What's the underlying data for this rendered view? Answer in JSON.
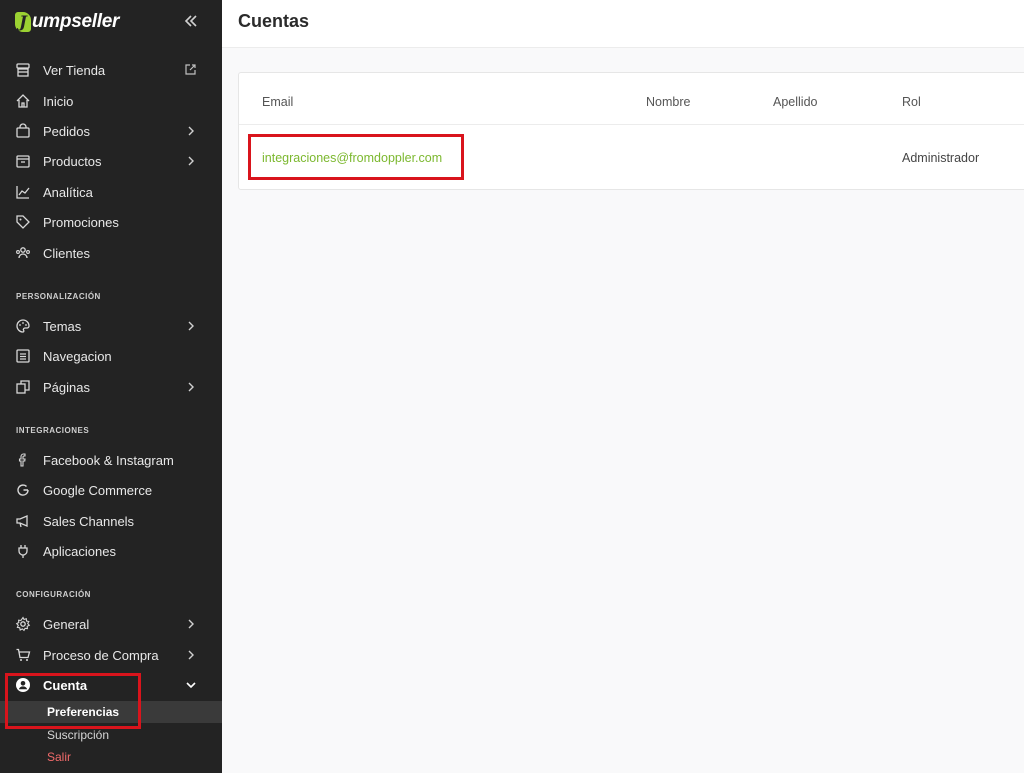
{
  "brand": {
    "name": "umpseller",
    "mark": "J"
  },
  "sidebar": {
    "main_items": [
      {
        "label": "Ver Tienda"
      },
      {
        "label": "Inicio"
      },
      {
        "label": "Pedidos"
      },
      {
        "label": "Productos"
      },
      {
        "label": "Analítica"
      },
      {
        "label": "Promociones"
      },
      {
        "label": "Clientes"
      }
    ],
    "sections": {
      "personalizacion": "PERSONALIZACIÓN",
      "integraciones": "INTEGRACIONES",
      "configuracion": "CONFIGURACIÓN"
    },
    "personalizacion_items": [
      {
        "label": "Temas"
      },
      {
        "label": "Navegacion"
      },
      {
        "label": "Páginas"
      }
    ],
    "integraciones_items": [
      {
        "label": "Facebook & Instagram"
      },
      {
        "label": "Google Commerce"
      },
      {
        "label": "Sales Channels"
      },
      {
        "label": "Aplicaciones"
      }
    ],
    "configuracion_items": [
      {
        "label": "General"
      },
      {
        "label": "Proceso de Compra"
      },
      {
        "label": "Cuenta"
      }
    ],
    "cuenta_sub": [
      {
        "label": "Preferencias"
      },
      {
        "label": "Suscripción"
      },
      {
        "label": "Salir"
      }
    ]
  },
  "page": {
    "title": "Cuentas"
  },
  "table": {
    "headers": {
      "email": "Email",
      "nombre": "Nombre",
      "apellido": "Apellido",
      "rol": "Rol"
    },
    "rows": [
      {
        "email": "integraciones@fromdoppler.com",
        "nombre": "",
        "apellido": "",
        "rol": "Administrador"
      }
    ]
  },
  "colors": {
    "accent": "#7cb82f",
    "highlight": "#d9141c",
    "sidebar_bg": "#232323"
  }
}
